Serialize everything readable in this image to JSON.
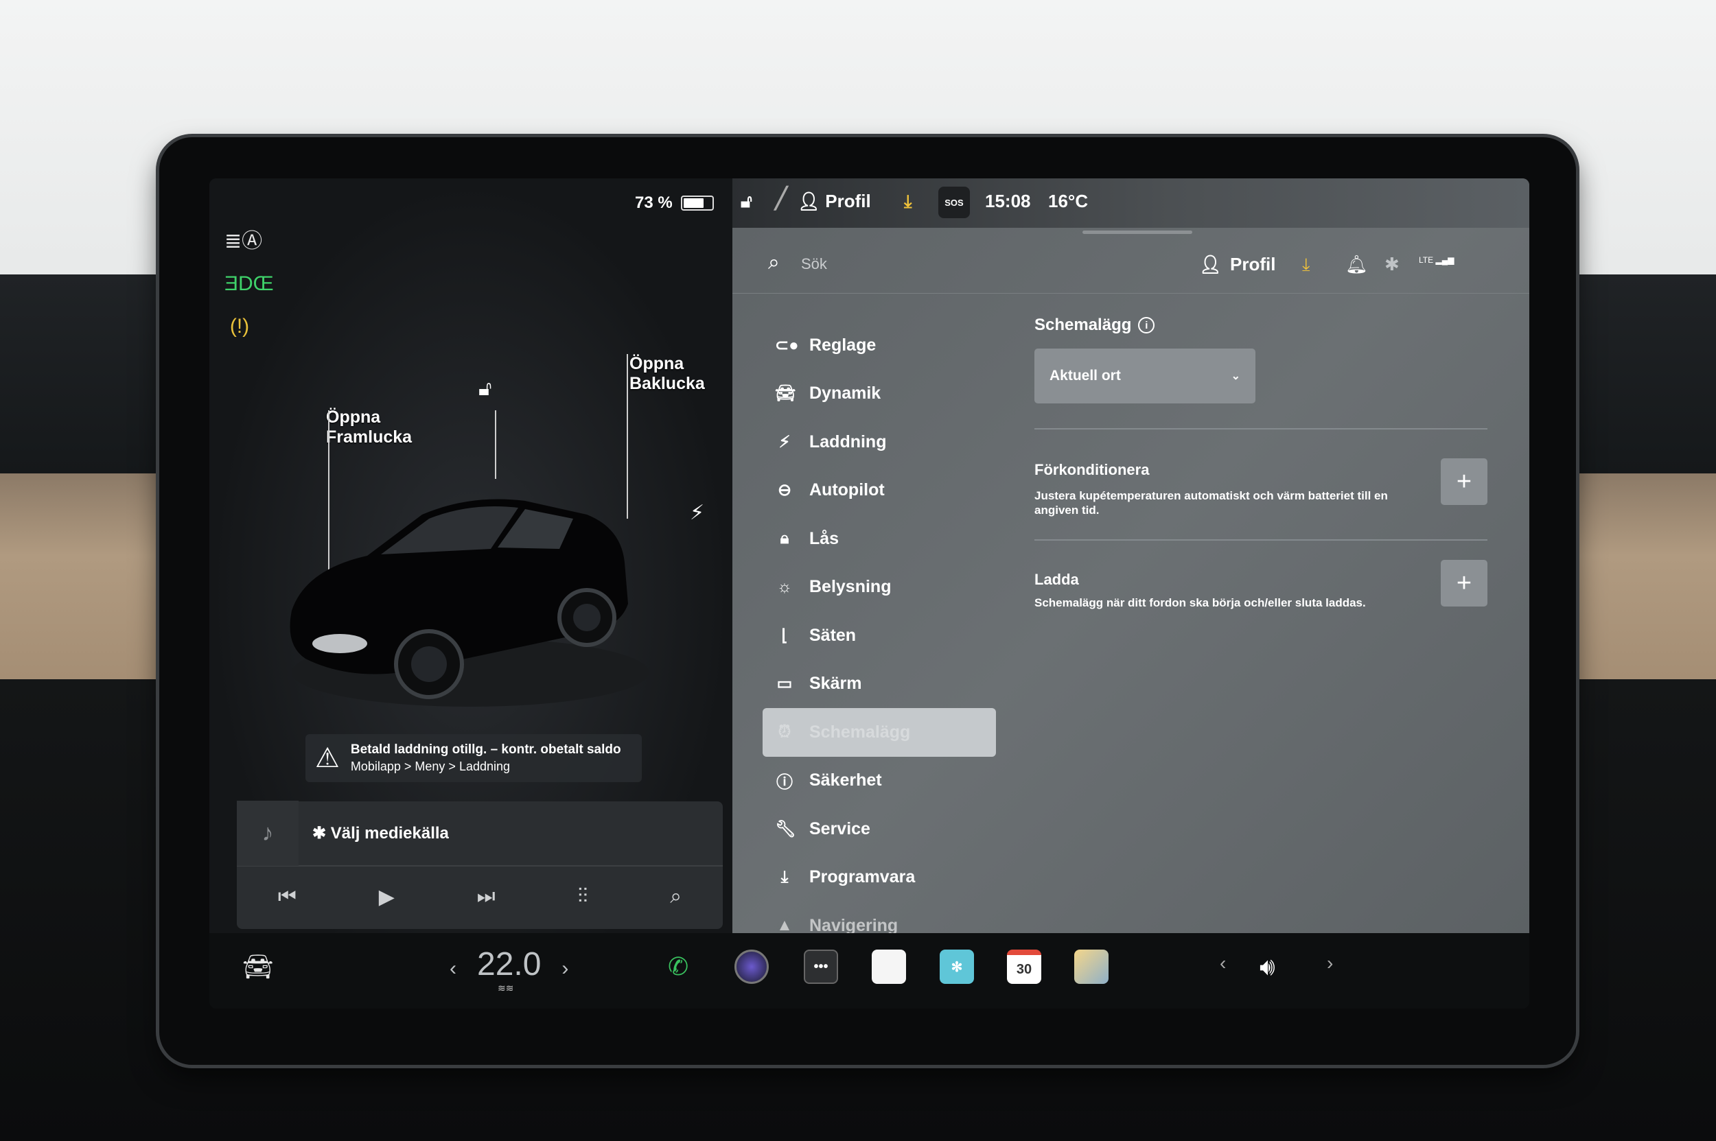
{
  "status": {
    "battery": "73 %",
    "battery_fraction": 0.73,
    "profile": "Profil",
    "time": "15:08",
    "temp": "16°C",
    "sos": "SOS"
  },
  "car": {
    "frunk_label": "Öppna\nFramlucka",
    "trunk_label": "Öppna\nBaklucka",
    "warning_line1": "Betald laddning otillg. – kontr. obetalt saldo",
    "warning_line2": "Mobilapp > Meny > Laddning"
  },
  "media": {
    "source": "Välj mediekälla"
  },
  "search": {
    "placeholder": "Sök"
  },
  "header": {
    "profile": "Profil",
    "network": "LTE"
  },
  "nav": [
    {
      "label": "Reglage",
      "icon": "toggle-icon"
    },
    {
      "label": "Dynamik",
      "icon": "car-icon"
    },
    {
      "label": "Laddning",
      "icon": "bolt-icon"
    },
    {
      "label": "Autopilot",
      "icon": "steering-wheel-icon"
    },
    {
      "label": "Lås",
      "icon": "lock-icon"
    },
    {
      "label": "Belysning",
      "icon": "light-icon"
    },
    {
      "label": "Säten",
      "icon": "seat-icon"
    },
    {
      "label": "Skärm",
      "icon": "display-icon"
    },
    {
      "label": "Schemalägg",
      "icon": "alarm-clock-icon"
    },
    {
      "label": "Säkerhet",
      "icon": "alert-circle-icon"
    },
    {
      "label": "Service",
      "icon": "wrench-icon"
    },
    {
      "label": "Programvara",
      "icon": "download-icon"
    },
    {
      "label": "Navigering",
      "icon": "navigation-icon"
    }
  ],
  "schedule": {
    "title": "Schemalägg",
    "location": "Aktuell ort",
    "precondition_title": "Förkonditionera",
    "precondition_desc": "Justera kupétemperaturen automatiskt och värm batteriet till en angiven tid.",
    "charge_title": "Ladda",
    "charge_desc": "Schemalägg när ditt fordon ska börja och/eller sluta laddas."
  },
  "bottom": {
    "temp": "22.0",
    "calendar_day": "30"
  }
}
